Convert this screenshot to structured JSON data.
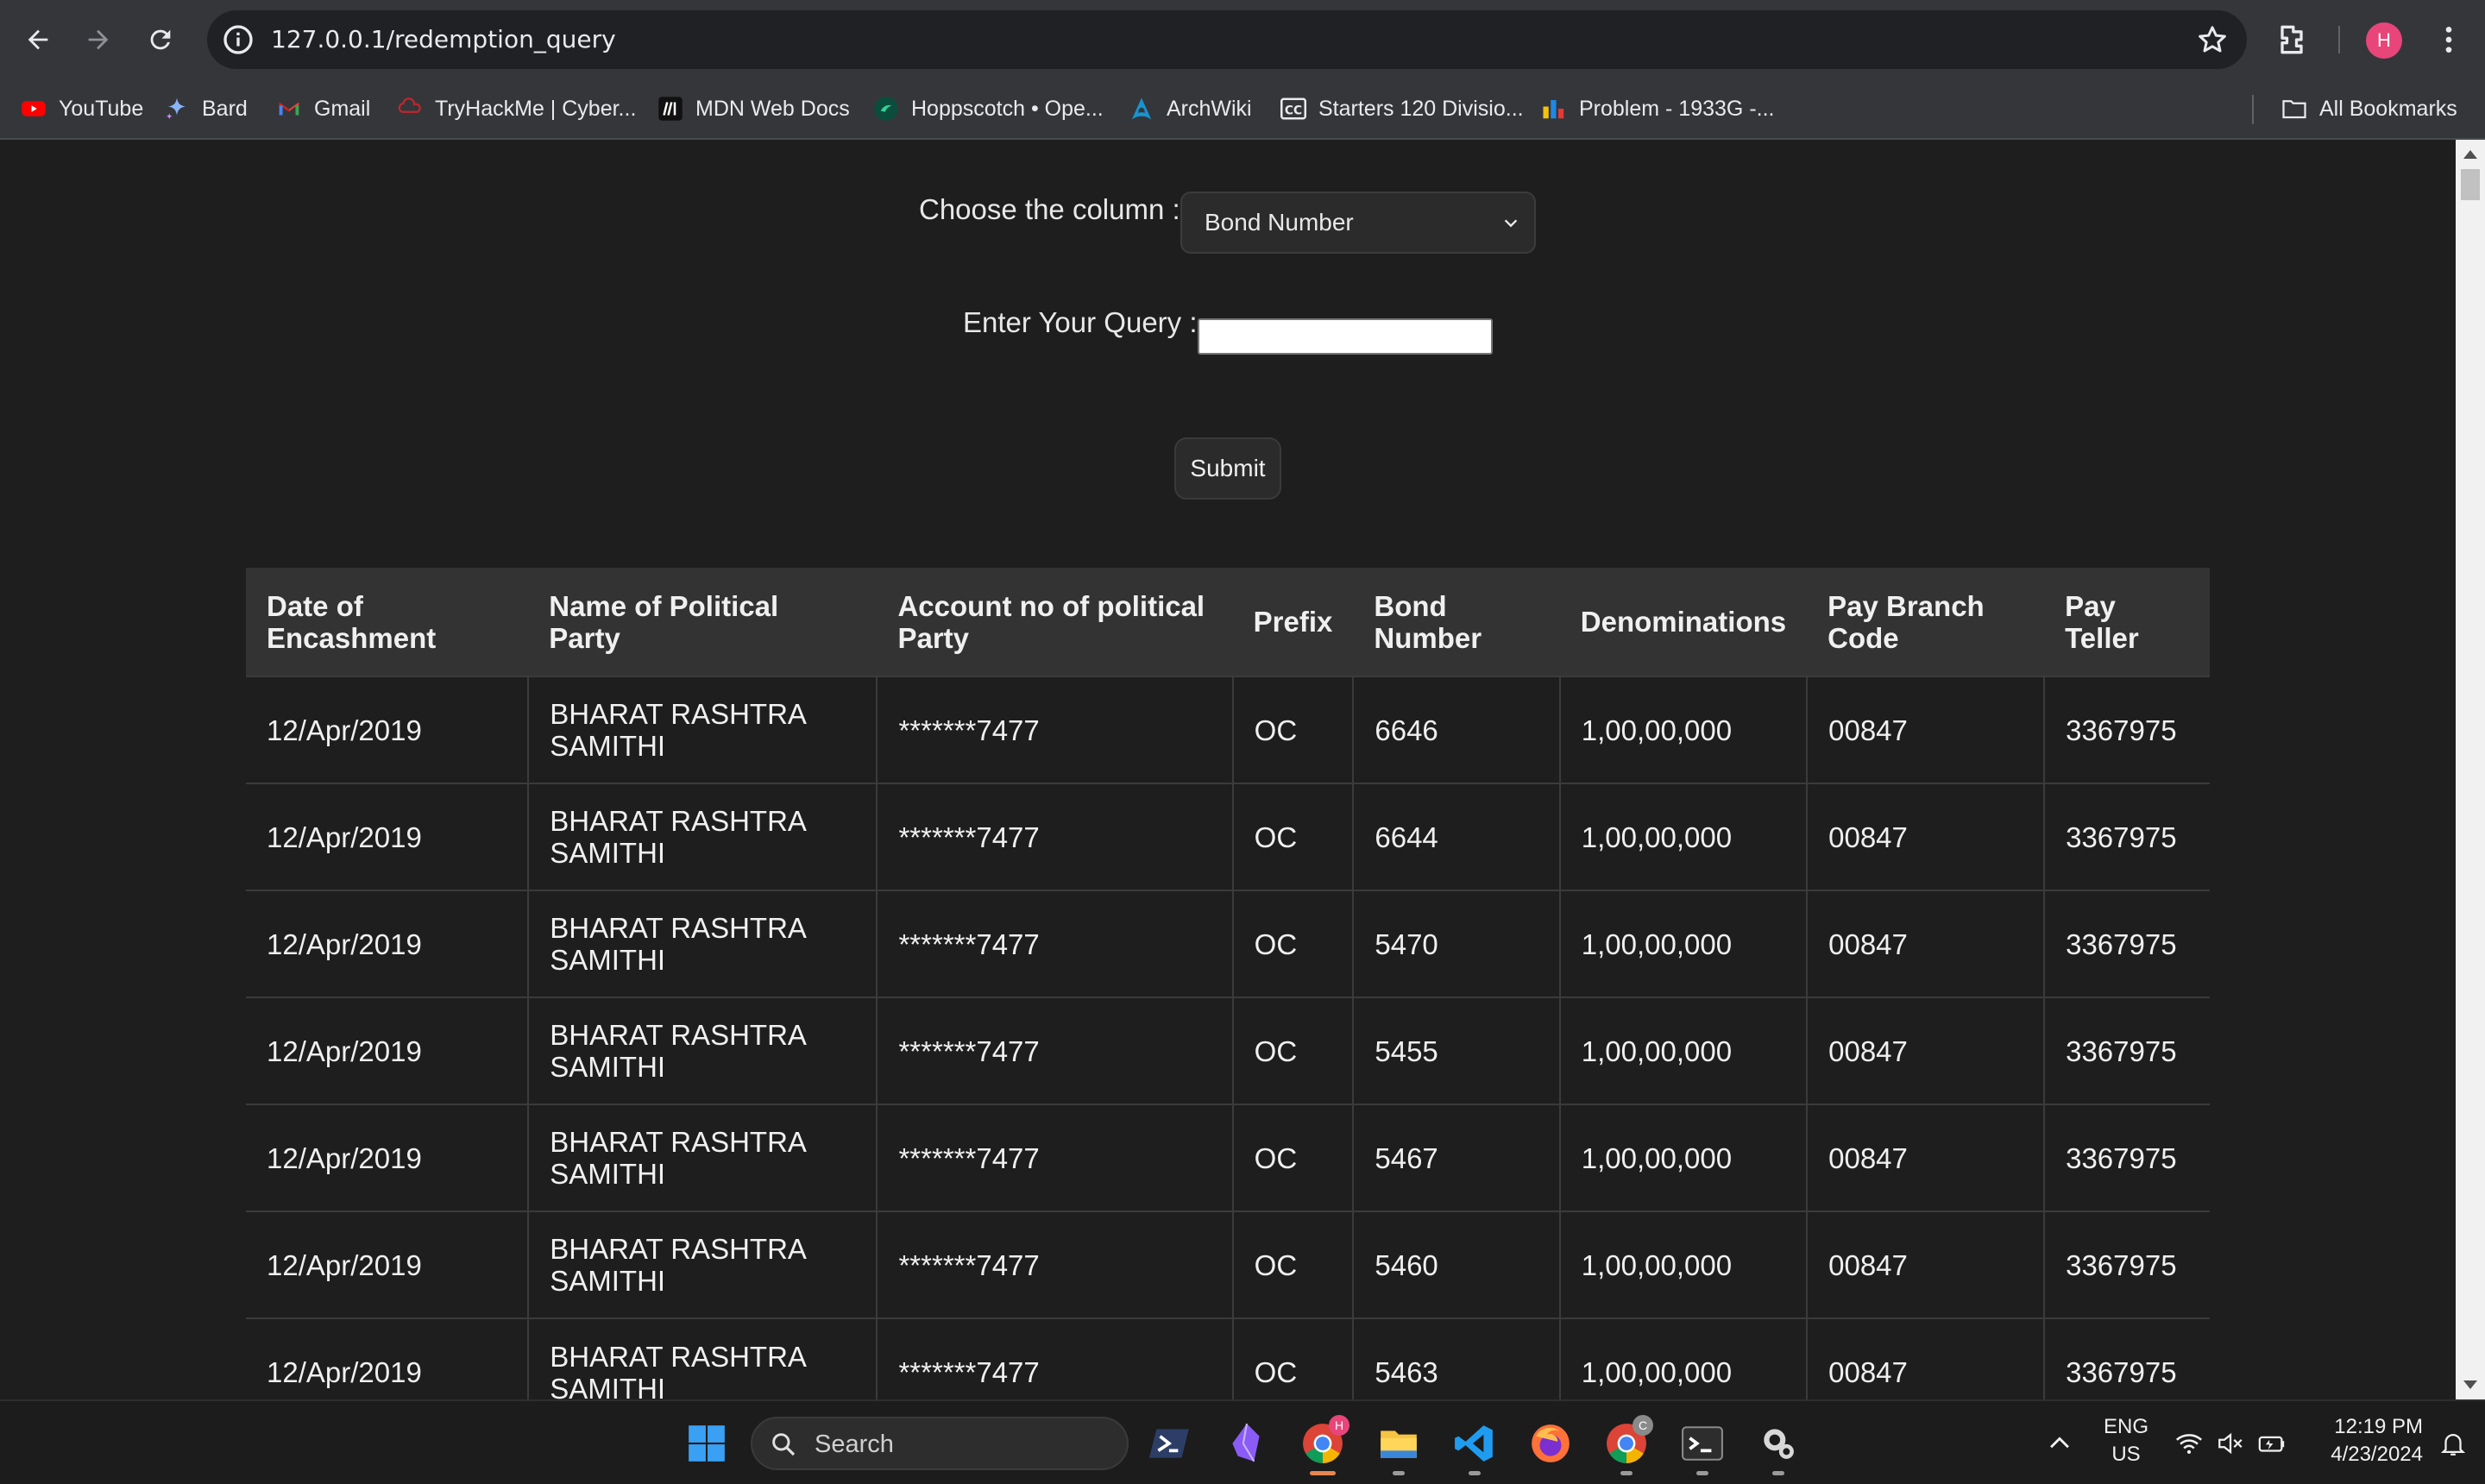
{
  "browser": {
    "url": "127.0.0.1/redemption_query",
    "profile_initial": "H",
    "bookmarks": [
      {
        "label": "YouTube",
        "icon": "youtube-icon"
      },
      {
        "label": "Bard",
        "icon": "bard-icon"
      },
      {
        "label": "Gmail",
        "icon": "gmail-icon"
      },
      {
        "label": "TryHackMe | Cyber...",
        "icon": "tryhackme-icon"
      },
      {
        "label": "MDN Web Docs",
        "icon": "mdn-icon"
      },
      {
        "label": "Hoppscotch • Ope...",
        "icon": "hoppscotch-icon"
      },
      {
        "label": "ArchWiki",
        "icon": "archwiki-icon"
      },
      {
        "label": "Starters 120 Divisio...",
        "icon": "codechef-icon"
      },
      {
        "label": "Problem - 1933G -...",
        "icon": "codeforces-icon"
      }
    ],
    "all_bookmarks_label": "All Bookmarks"
  },
  "form": {
    "column_label": "Choose the column :",
    "column_selected": "Bond Number",
    "query_label": "Enter Your Query :",
    "query_value": "",
    "submit_label": "Submit"
  },
  "table": {
    "headers": [
      "Date of Encashment",
      "Name of Political Party",
      "Account no of political Party",
      "Prefix",
      "Bond Number",
      "Denominations",
      "Pay Branch Code",
      "Pay Teller"
    ],
    "rows": [
      [
        "12/Apr/2019",
        "BHARAT RASHTRA SAMITHI",
        "*******7477",
        "OC",
        "6646",
        "1,00,00,000",
        "00847",
        "3367975"
      ],
      [
        "12/Apr/2019",
        "BHARAT RASHTRA SAMITHI",
        "*******7477",
        "OC",
        "6644",
        "1,00,00,000",
        "00847",
        "3367975"
      ],
      [
        "12/Apr/2019",
        "BHARAT RASHTRA SAMITHI",
        "*******7477",
        "OC",
        "5470",
        "1,00,00,000",
        "00847",
        "3367975"
      ],
      [
        "12/Apr/2019",
        "BHARAT RASHTRA SAMITHI",
        "*******7477",
        "OC",
        "5455",
        "1,00,00,000",
        "00847",
        "3367975"
      ],
      [
        "12/Apr/2019",
        "BHARAT RASHTRA SAMITHI",
        "*******7477",
        "OC",
        "5467",
        "1,00,00,000",
        "00847",
        "3367975"
      ],
      [
        "12/Apr/2019",
        "BHARAT RASHTRA SAMITHI",
        "*******7477",
        "OC",
        "5460",
        "1,00,00,000",
        "00847",
        "3367975"
      ],
      [
        "12/Apr/2019",
        "BHARAT RASHTRA SAMITHI",
        "*******7477",
        "OC",
        "5463",
        "1,00,00,000",
        "00847",
        "3367975"
      ]
    ]
  },
  "taskbar": {
    "search_placeholder": "Search",
    "language": "ENG",
    "region": "US",
    "time": "12:19 PM",
    "date": "4/23/2024",
    "chrome_badge_initial": "H",
    "chrome2_badge_initial": "C"
  },
  "colors": {
    "page_bg": "#1e1e1e",
    "header_bg": "#333333",
    "accent_avatar": "#e8457a"
  }
}
